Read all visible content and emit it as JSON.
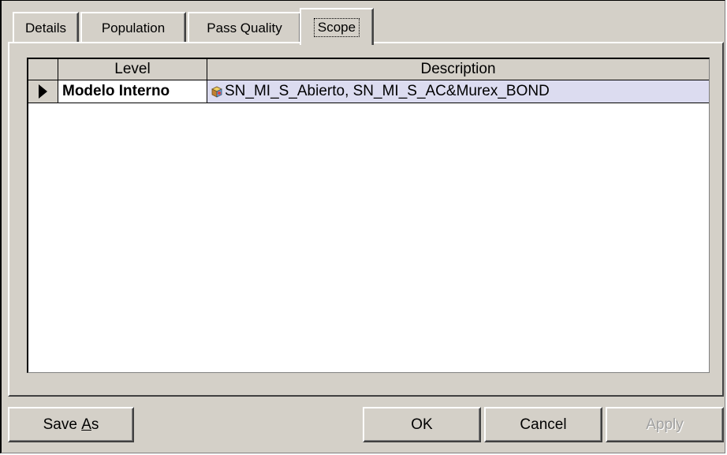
{
  "tabs": [
    {
      "label": "Details",
      "active": false
    },
    {
      "label": "Population",
      "active": false
    },
    {
      "label": "Pass Quality",
      "active": false
    },
    {
      "label": "Scope",
      "active": true
    }
  ],
  "grid": {
    "columns": [
      "Level",
      "Description"
    ],
    "rows": [
      {
        "level": "Modelo Interno",
        "description": "SN_MI_S_Abierto, SN_MI_S_AC&Murex_BOND",
        "icon": "cube-icon",
        "selected": true
      }
    ]
  },
  "buttons": {
    "save_as_pre": "Save ",
    "save_as_key": "A",
    "save_as_post": "s",
    "ok": "OK",
    "cancel": "Cancel",
    "apply": "Apply"
  },
  "colors": {
    "face": "#d4d0c8",
    "row_highlight": "#dcdcf0"
  }
}
